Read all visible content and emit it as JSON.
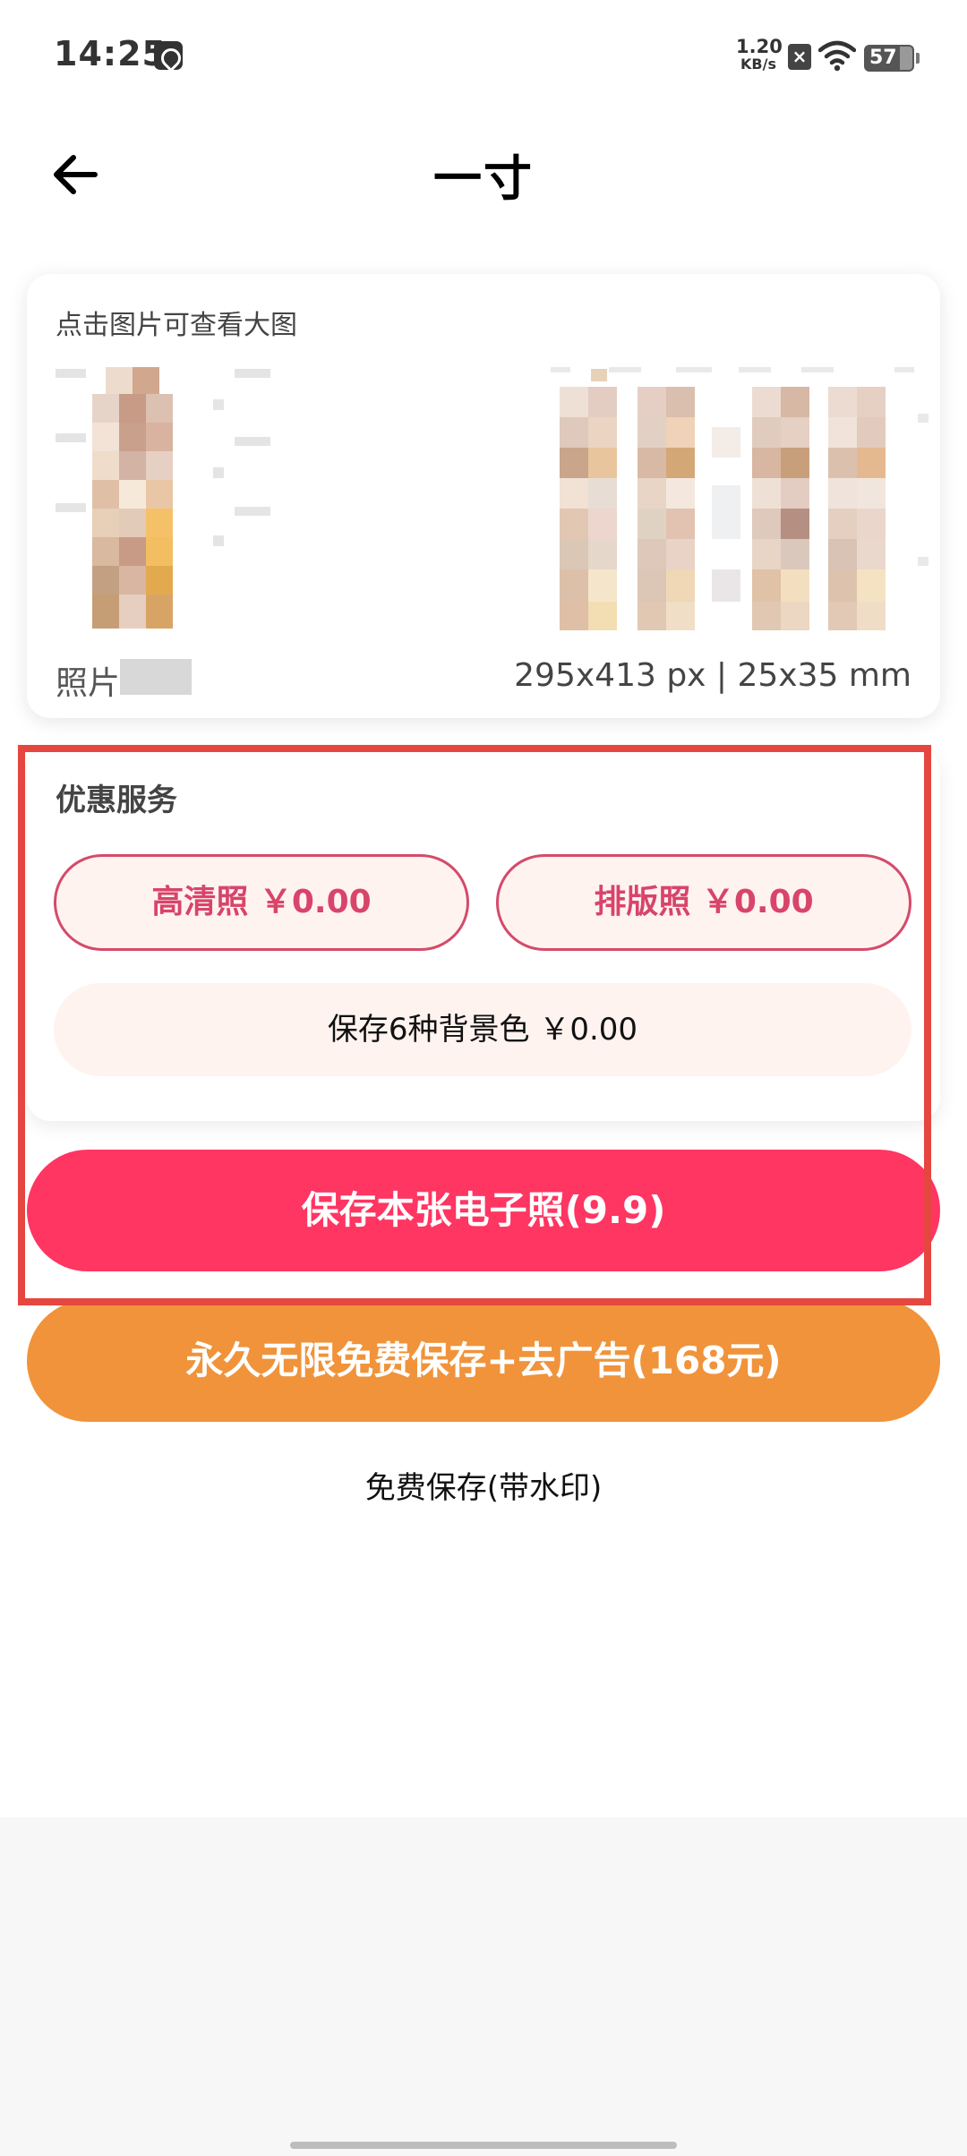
{
  "status_bar": {
    "time": "14:25",
    "net_speed_value": "1.20",
    "net_speed_unit": "KB/s",
    "battery": "57",
    "icons": [
      "app-icon",
      "sim-x-icon",
      "wifi-icon",
      "battery-icon"
    ]
  },
  "header": {
    "title": "一寸",
    "back_icon": "arrow-left-icon"
  },
  "preview": {
    "hint": "点击图片可查看大图",
    "name_label": "照片",
    "size": "295x413 px | 25x35 mm"
  },
  "services": {
    "title": "优惠服务",
    "hd_photo": "高清照 ￥0.00",
    "layout_photo": "排版照 ￥0.00",
    "bg_colors": "保存6种背景色 ￥0.00"
  },
  "actions": {
    "save_this": "保存本张电子照(9.9)",
    "unlimited": "永久无限免费保存+去广告(168元)",
    "free_save": "免费保存(带水印)"
  },
  "colors": {
    "primary_red": "#ff3562",
    "orange": "#f0933a",
    "pill_border": "#d54a6a",
    "pill_bg": "#fff3f0",
    "highlight": "#e5463f"
  }
}
